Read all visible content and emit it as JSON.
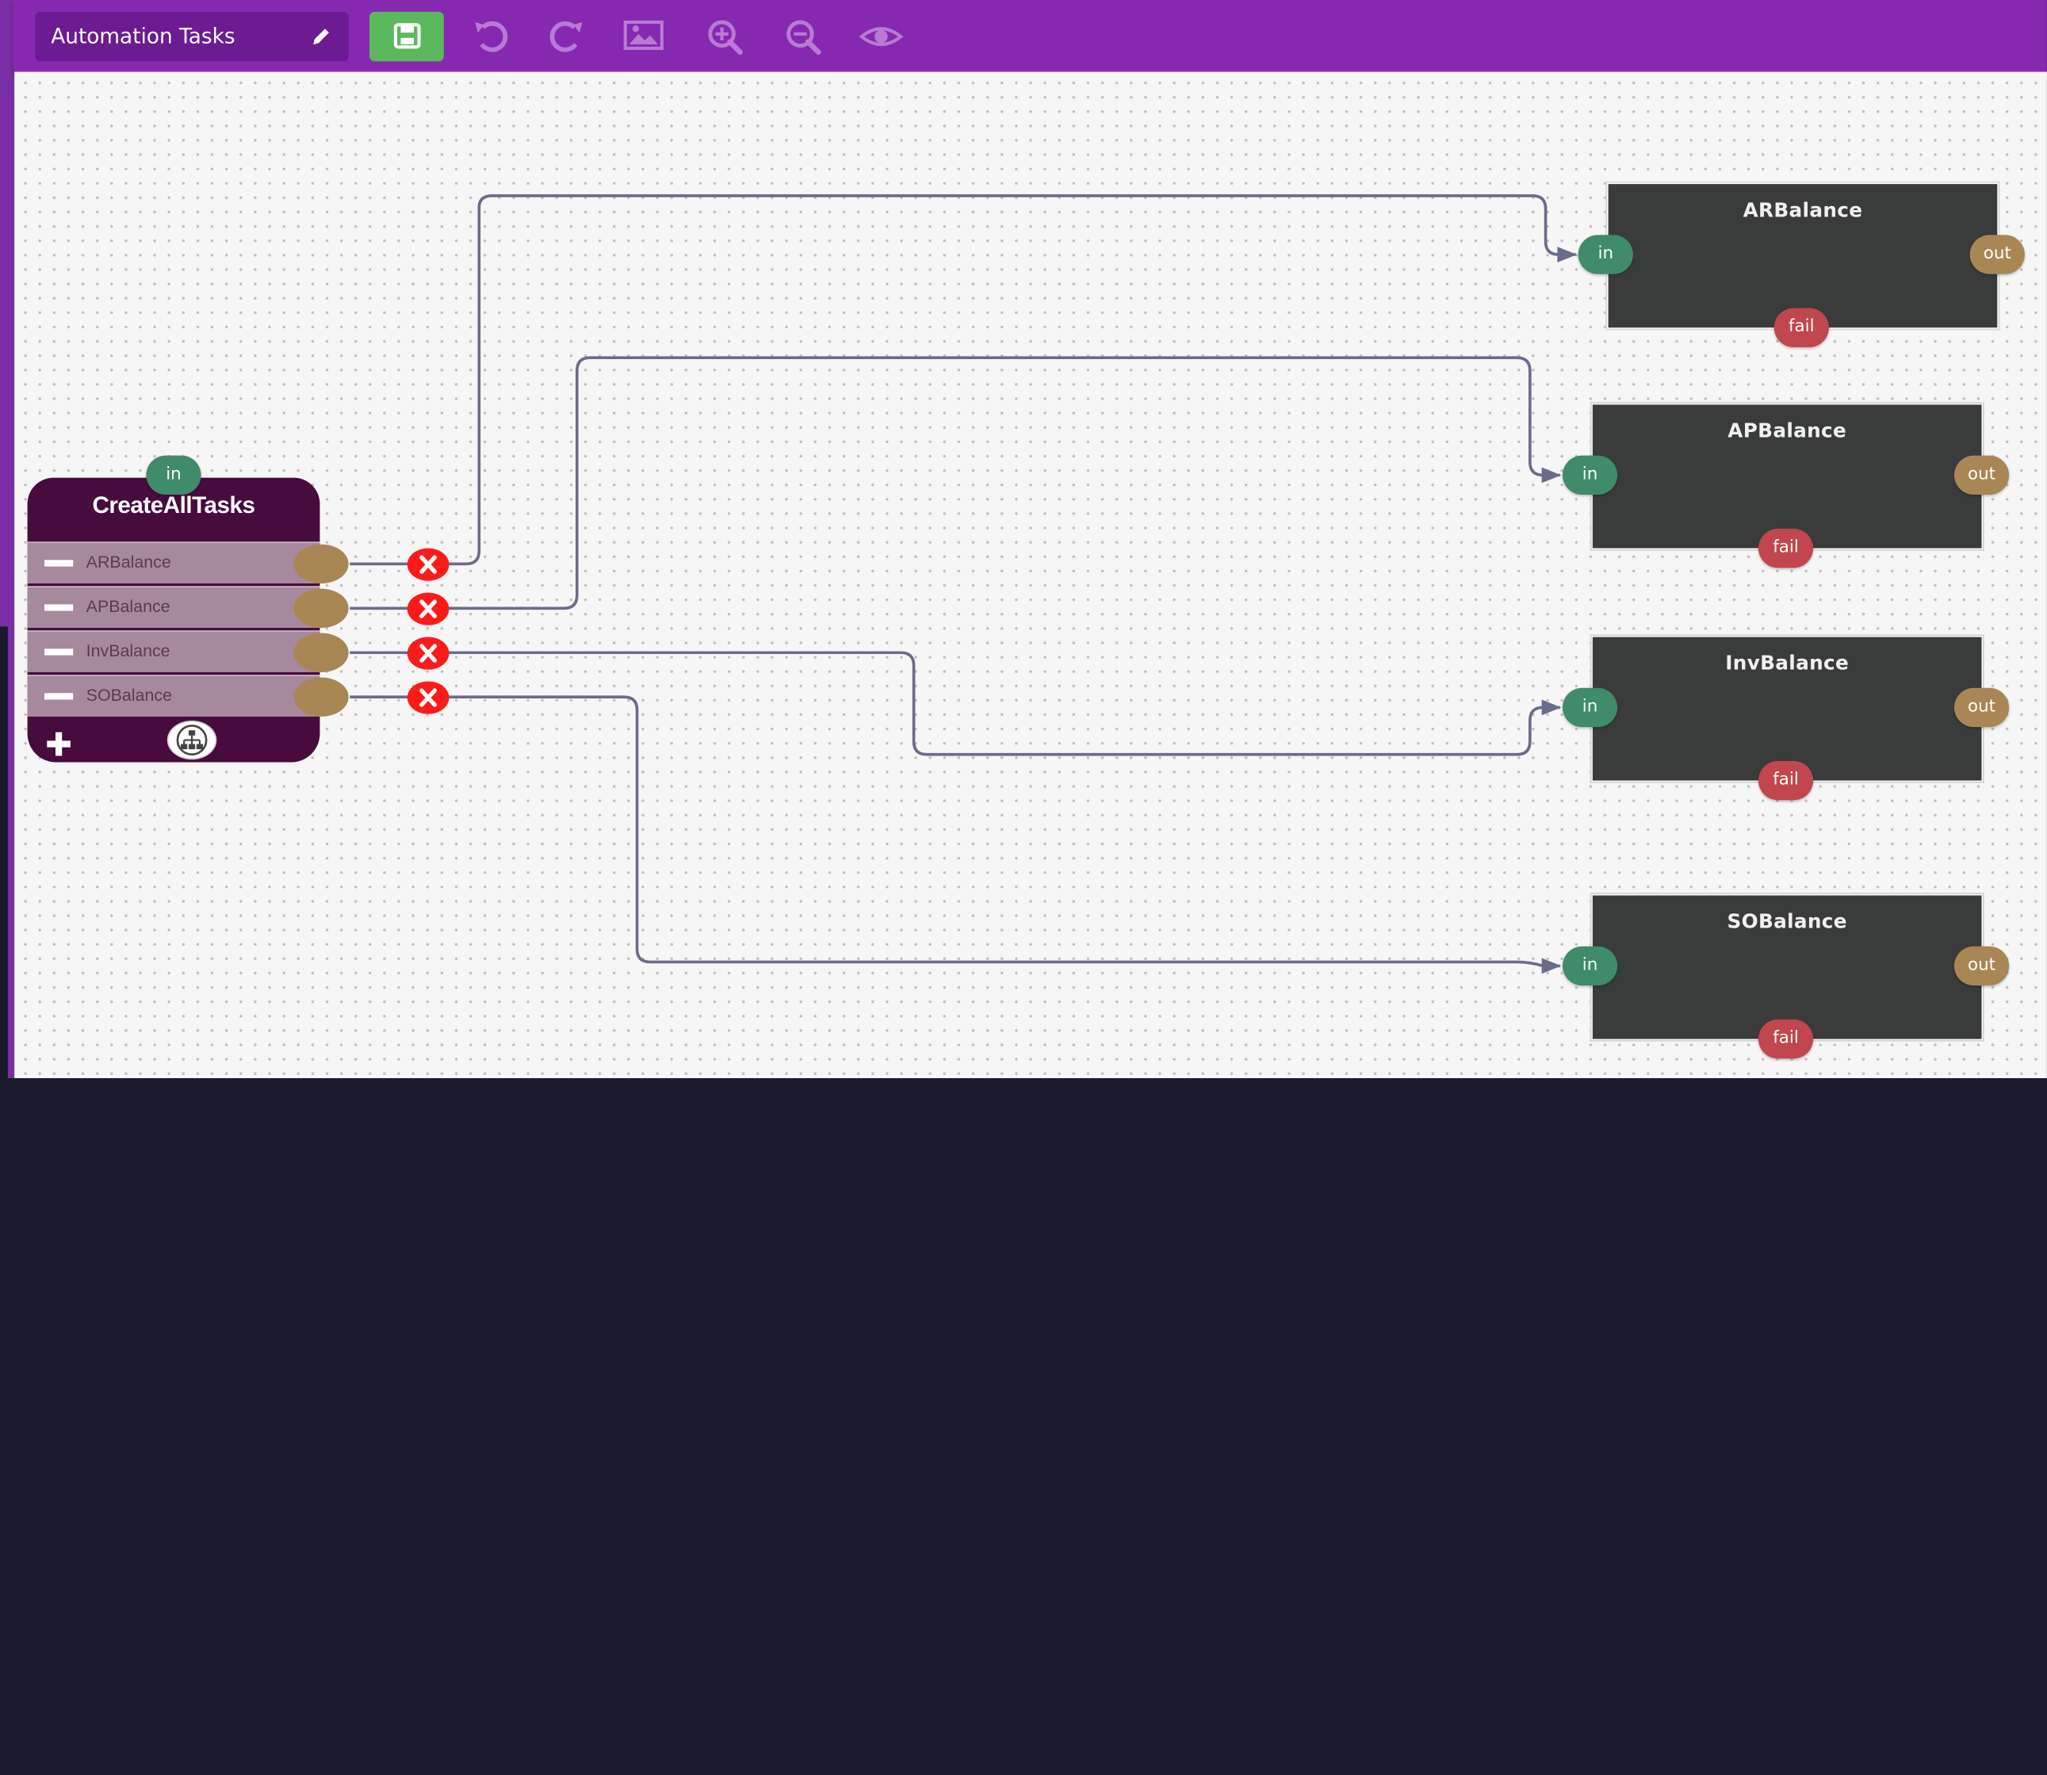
{
  "toolbar": {
    "title": "Automation Tasks",
    "colors": {
      "bar": "#8728b0",
      "save": "#5cb85c"
    },
    "icons": [
      "pencil-icon",
      "save-icon",
      "undo-icon",
      "redo-icon",
      "image-icon",
      "zoom-in-icon",
      "zoom-out-icon",
      "eye-icon"
    ]
  },
  "main_node": {
    "title": "CreateAllTasks",
    "in_label": "in",
    "outlets": [
      {
        "label": "ARBalance"
      },
      {
        "label": "APBalance"
      },
      {
        "label": "InvBalance"
      },
      {
        "label": "SOBalance"
      }
    ]
  },
  "task_nodes": [
    {
      "title": "ARBalance",
      "in": "in",
      "out": "out",
      "fail": "fail"
    },
    {
      "title": "APBalance",
      "in": "in",
      "out": "out",
      "fail": "fail"
    },
    {
      "title": "InvBalance",
      "in": "in",
      "out": "out",
      "fail": "fail"
    },
    {
      "title": "SOBalance",
      "in": "in",
      "out": "out",
      "fail": "fail"
    }
  ],
  "colors": {
    "port_in": "#3f8b6a",
    "port_out": "#a88754",
    "port_fail": "#c1464d",
    "wire": "#6b6b8a",
    "task_bg": "#3a3c3c",
    "main_bg": "#470b3e"
  }
}
